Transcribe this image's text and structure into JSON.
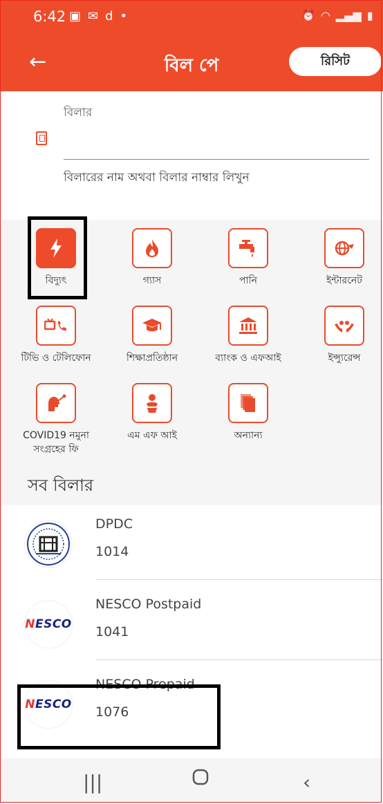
{
  "status": {
    "time": "6:42",
    "carrier_mark": "d",
    "dot": "•"
  },
  "appbar": {
    "title": "বিল পে",
    "receipt_button": "রিসিট"
  },
  "biller": {
    "label": "বিলার",
    "hint": "বিলারের নাম অথবা বিলার নাম্বার লিখুন",
    "value": ""
  },
  "categories": [
    {
      "label": "বিদ্যুৎ",
      "icon": "lightning-icon",
      "active": true
    },
    {
      "label": "গ্যাস",
      "icon": "flame-icon"
    },
    {
      "label": "পানি",
      "icon": "water-tap-icon"
    },
    {
      "label": "ইন্টারনেট",
      "icon": "globe-icon"
    },
    {
      "label": "টিভি ও টেলিফোন",
      "icon": "tv-phone-icon"
    },
    {
      "label": "শিক্ষাপ্রতিষ্ঠান",
      "icon": "graduation-cap-icon"
    },
    {
      "label": "ব্যাংক ও এফআই",
      "icon": "bank-icon"
    },
    {
      "label": "ইন্স্যুরেন্স",
      "icon": "insurance-hands-icon"
    },
    {
      "label": "COVID19 নমুনা সংগ্রহের ফি",
      "icon": "covid-test-icon"
    },
    {
      "label": "এম এফ আই",
      "icon": "mfi-icon"
    },
    {
      "label": "অন্যান্য",
      "icon": "documents-icon"
    }
  ],
  "section_title": "সব বিলার",
  "billers": [
    {
      "name": "DPDC",
      "code": "1014",
      "logo": "dpdc-logo"
    },
    {
      "name": "NESCO Postpaid",
      "code": "1041",
      "logo": "nesco-logo"
    },
    {
      "name": "NESCO Prepaid",
      "code": "1076",
      "logo": "nesco-logo"
    }
  ],
  "nesco_logo_text": {
    "first": "N",
    "rest": "ESCO"
  },
  "colors": {
    "accent": "#ee4b2b",
    "highlight": "#000000"
  }
}
